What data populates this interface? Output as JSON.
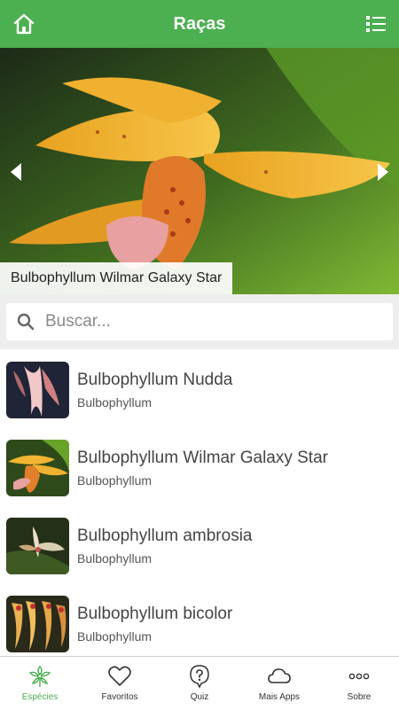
{
  "header": {
    "title": "Raças"
  },
  "hero": {
    "caption": "Bulbophyllum Wilmar Galaxy Star"
  },
  "search": {
    "placeholder": "Buscar..."
  },
  "items": [
    {
      "name": "Bulbophyllum Nudda",
      "genus": "Bulbophyllum"
    },
    {
      "name": "Bulbophyllum Wilmar Galaxy Star",
      "genus": "Bulbophyllum"
    },
    {
      "name": "Bulbophyllum ambrosia",
      "genus": "Bulbophyllum"
    },
    {
      "name": "Bulbophyllum bicolor",
      "genus": "Bulbophyllum"
    }
  ],
  "tabs": [
    {
      "label": "Espécies",
      "icon": "flower-icon",
      "active": true
    },
    {
      "label": "Favoritos",
      "icon": "heart-icon"
    },
    {
      "label": "Quiz",
      "icon": "question-icon"
    },
    {
      "label": "Mais Apps",
      "icon": "cloud-icon"
    },
    {
      "label": "Sobre",
      "icon": "more-dots-icon"
    }
  ],
  "colors": {
    "accent": "#4caf50",
    "searchbar_bg": "#eeeeee"
  }
}
